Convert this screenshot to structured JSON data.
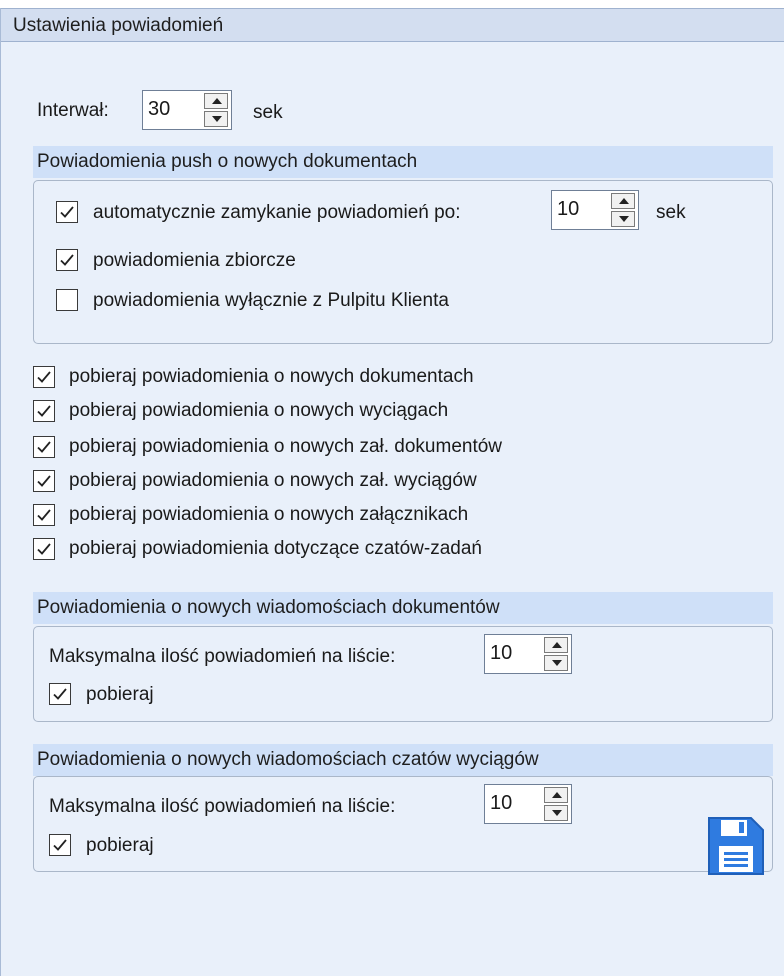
{
  "panel": {
    "title": "Ustawienia powiadomień"
  },
  "interval": {
    "label": "Interwał:",
    "value": "30",
    "unit": "sek"
  },
  "push_group": {
    "title": "Powiadomienia push o nowych dokumentach",
    "auto_close": {
      "label": "automatycznie zamykanie powiadomień po:",
      "checked": true,
      "value": "10",
      "unit": "sek"
    },
    "summary": {
      "label": "powiadomienia zbiorcze",
      "checked": true
    },
    "client_only": {
      "label": "powiadomienia wyłącznie z Pulpitu Klienta",
      "checked": false
    }
  },
  "fetch_options": [
    {
      "label": "pobieraj powiadomienia o nowych dokumentach",
      "checked": true
    },
    {
      "label": "pobieraj powiadomienia o nowych wyciągach",
      "checked": true
    },
    {
      "label": "pobieraj powiadomienia o nowych zał. dokumentów",
      "checked": true
    },
    {
      "label": "pobieraj powiadomienia o nowych zał. wyciągów",
      "checked": true
    },
    {
      "label": "pobieraj powiadomienia o nowych załącznikach",
      "checked": true
    },
    {
      "label": "pobieraj powiadomienia dotyczące czatów-zadań",
      "checked": true
    }
  ],
  "doc_messages_group": {
    "title": "Powiadomienia o nowych wiadomościach dokumentów",
    "max_label": "Maksymalna ilość powiadomień na liście:",
    "max_value": "10",
    "fetch": {
      "label": "pobieraj",
      "checked": true
    }
  },
  "statement_chats_group": {
    "title": "Powiadomienia o nowych wiadomościach czatów wyciągów",
    "max_label": "Maksymalna ilość powiadomień na liście:",
    "max_value": "10",
    "fetch": {
      "label": "pobieraj",
      "checked": true
    }
  },
  "icons": {
    "save": "floppy-disk-icon",
    "save_color": "#2f7be0"
  }
}
